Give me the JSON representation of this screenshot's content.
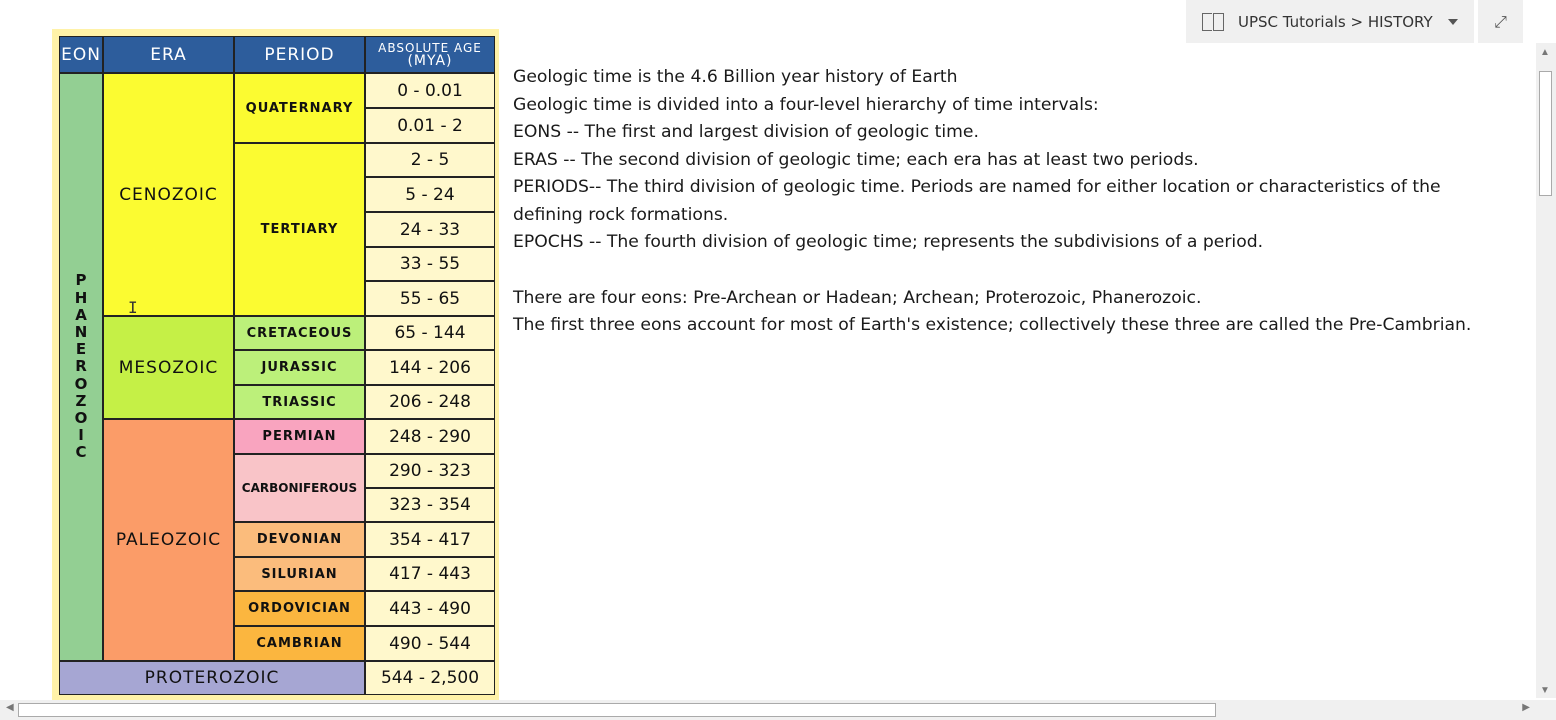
{
  "location_bar": {
    "path": "UPSC Tutorials > HISTORY"
  },
  "table": {
    "headers": {
      "eon": "EON",
      "era": "ERA",
      "period": "PERIOD",
      "age_line1": "ABSOLUTE AGE",
      "age_line2": "(MYA)"
    },
    "eon_phanerozoic": "PHANEROZOIC",
    "eras": {
      "cenozoic": "CENOZOIC",
      "mesozoic": "MESOZOIC",
      "paleozoic": "PALEOZOIC",
      "proterozoic": "PROTEROZOIC"
    },
    "periods": {
      "quaternary": "QUATERNARY",
      "tertiary": "TERTIARY",
      "cretaceous": "CRETACEOUS",
      "jurassic": "JURASSIC",
      "triassic": "TRIASSIC",
      "permian": "PERMIAN",
      "carboniferous": "CARBONIFEROUS",
      "devonian": "DEVONIAN",
      "silurian": "SILURIAN",
      "ordovician": "ORDOVICIAN",
      "cambrian": "CAMBRIAN"
    },
    "ages": [
      "0 - 0.01",
      "0.01 - 2",
      "2 - 5",
      "5 - 24",
      "24 - 33",
      "33 - 55",
      "55 - 65",
      "65 - 144",
      "144 - 206",
      "206 - 248",
      "248 - 290",
      "290 - 323",
      "323 - 354",
      "354 - 417",
      "417 - 443",
      "443 - 490",
      "490 - 544",
      "544 - 2,500"
    ]
  },
  "notes": {
    "lines": [
      "Geologic time is the 4.6 Billion year history of Earth",
      "Geologic time is divided into a four-level hierarchy of time intervals:",
      "EONS -- The first and largest division of geologic time.",
      "ERAS -- The second division of geologic time; each era has at least two periods.",
      "PERIODS-- The third division of geologic time. Periods are named for either location or characteristics of the defining rock formations.",
      "EPOCHS -- The fourth division of geologic time; represents the subdivisions of a period."
    ],
    "lines2": [
      "There are four eons: Pre-Archean or Hadean; Archean; Proterozoic, Phanerozoic.",
      "The first three eons account for most of Earth's existence; collectively these three are called the Pre-Cambrian."
    ]
  }
}
